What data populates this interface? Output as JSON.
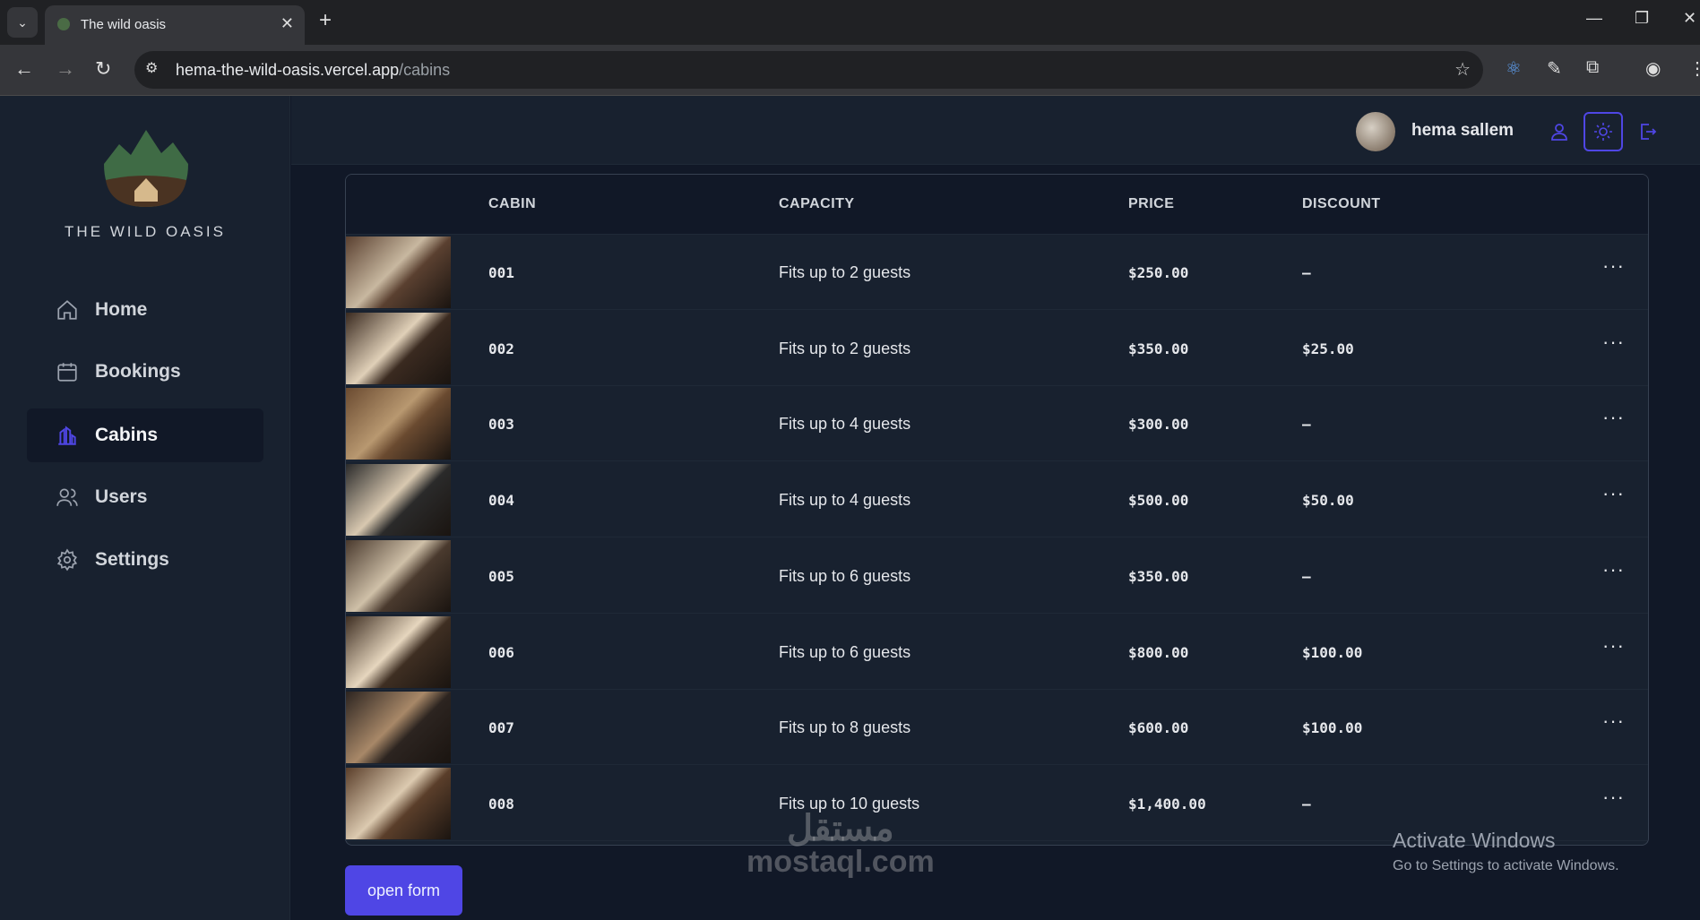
{
  "browser": {
    "tab_title": "The wild oasis",
    "url_host": "hema-the-wild-oasis.vercel.app",
    "url_path": "/cabins"
  },
  "sidebar": {
    "brand": "THE WILD OASIS",
    "items": [
      {
        "label": "Home",
        "icon": "home-icon"
      },
      {
        "label": "Bookings",
        "icon": "calendar-icon"
      },
      {
        "label": "Cabins",
        "icon": "chart-icon",
        "active": true
      },
      {
        "label": "Users",
        "icon": "users-icon"
      },
      {
        "label": "Settings",
        "icon": "gear-icon"
      }
    ]
  },
  "header": {
    "user_name": "hema sallem"
  },
  "table": {
    "headers": [
      "CABIN",
      "CAPACITY",
      "PRICE",
      "DISCOUNT"
    ],
    "rows": [
      {
        "name": "001",
        "capacity": "Fits up to 2 guests",
        "price": "$250.00",
        "discount": "–"
      },
      {
        "name": "002",
        "capacity": "Fits up to 2 guests",
        "price": "$350.00",
        "discount": "$25.00"
      },
      {
        "name": "003",
        "capacity": "Fits up to 4 guests",
        "price": "$300.00",
        "discount": "–"
      },
      {
        "name": "004",
        "capacity": "Fits up to 4 guests",
        "price": "$500.00",
        "discount": "$50.00"
      },
      {
        "name": "005",
        "capacity": "Fits up to 6 guests",
        "price": "$350.00",
        "discount": "–"
      },
      {
        "name": "006",
        "capacity": "Fits up to 6 guests",
        "price": "$800.00",
        "discount": "$100.00"
      },
      {
        "name": "007",
        "capacity": "Fits up to 8 guests",
        "price": "$600.00",
        "discount": "$100.00"
      },
      {
        "name": "008",
        "capacity": "Fits up to 10 guests",
        "price": "$1,400.00",
        "discount": "–"
      }
    ]
  },
  "open_form_label": "open form",
  "watermark": {
    "arabic": "مستقل",
    "latin": "mostaql.com"
  },
  "windows": {
    "title": "Activate Windows",
    "subtitle": "Go to Settings to activate Windows."
  },
  "colors": {
    "accent": "#4f46e5",
    "bg": "#111827",
    "panel": "#18212f"
  }
}
